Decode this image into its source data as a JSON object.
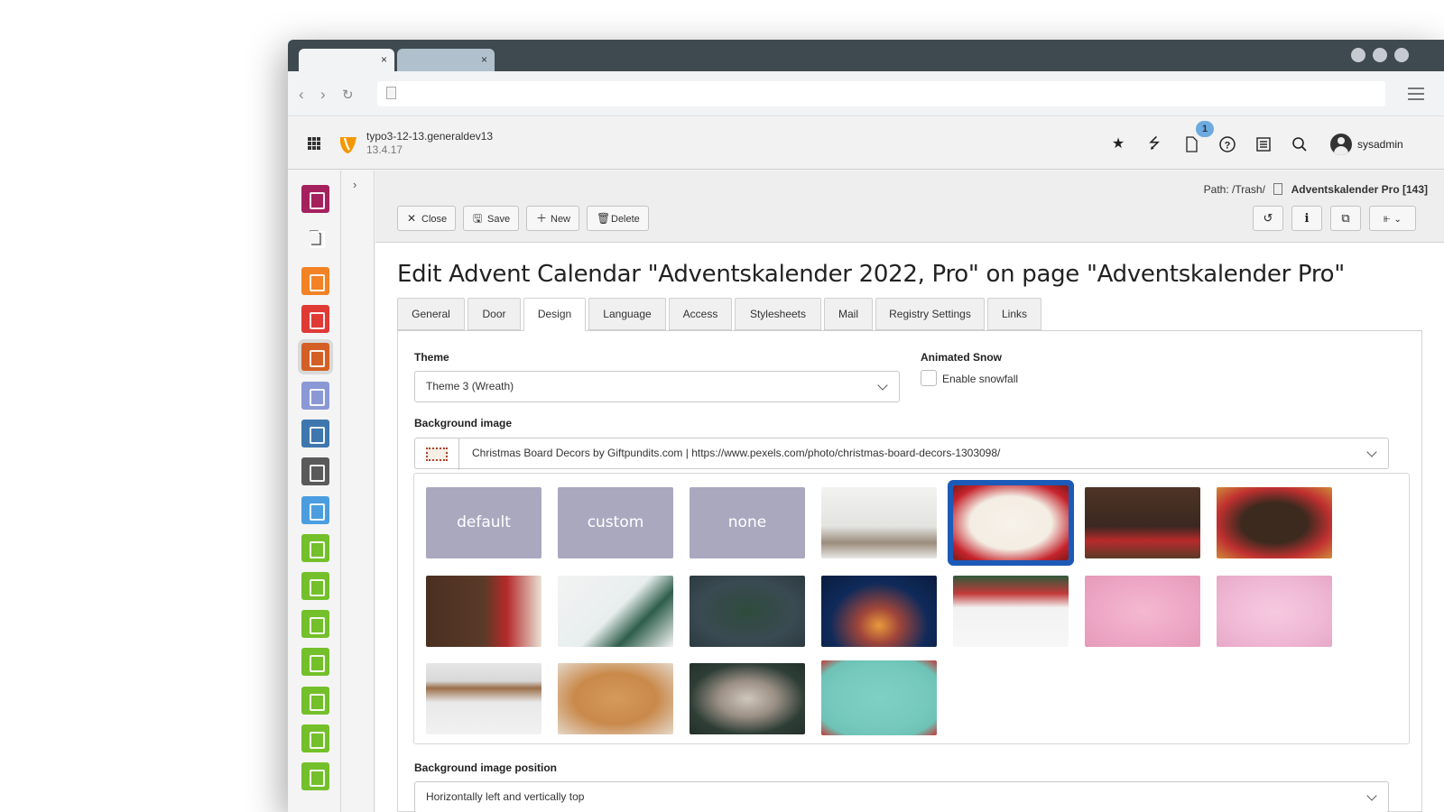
{
  "browser": {
    "tab1_close": "×",
    "tab2_close": "×"
  },
  "header": {
    "site_name": "typo3-12-13.generaldev13",
    "version": "13.4.17",
    "notification_count": "1",
    "username": "sysadmin"
  },
  "docheader": {
    "path_label": "Path: /Trash/",
    "record_title": "Adventskalender Pro [143]",
    "buttons": {
      "close": "Close",
      "save": "Save",
      "new": "New",
      "delete": "Delete"
    }
  },
  "page": {
    "title": "Edit Advent Calendar \"Adventskalender 2022, Pro\" on page \"Adventskalender Pro\""
  },
  "tabs": [
    "General",
    "Door",
    "Design",
    "Language",
    "Access",
    "Stylesheets",
    "Mail",
    "Registry Settings",
    "Links"
  ],
  "active_tab": "Design",
  "form": {
    "theme_label": "Theme",
    "theme_value": "Theme 3 (Wreath)",
    "snow_label": "Animated Snow",
    "snow_checkbox_label": "Enable snowfall",
    "snow_checked": false,
    "bg_image_label": "Background image",
    "bg_image_value": "Christmas Board Decors by Giftpundits.com | https://www.pexels.com/photo/christmas-board-decors-1303098/",
    "gallery_options": [
      "default",
      "custom",
      "none"
    ],
    "bg_position_label": "Background image position",
    "bg_position_value": "Horizontally left and vertically top"
  },
  "colors": {
    "selected_border": "#1c5ab8",
    "typo3_orange": "#f49700"
  }
}
